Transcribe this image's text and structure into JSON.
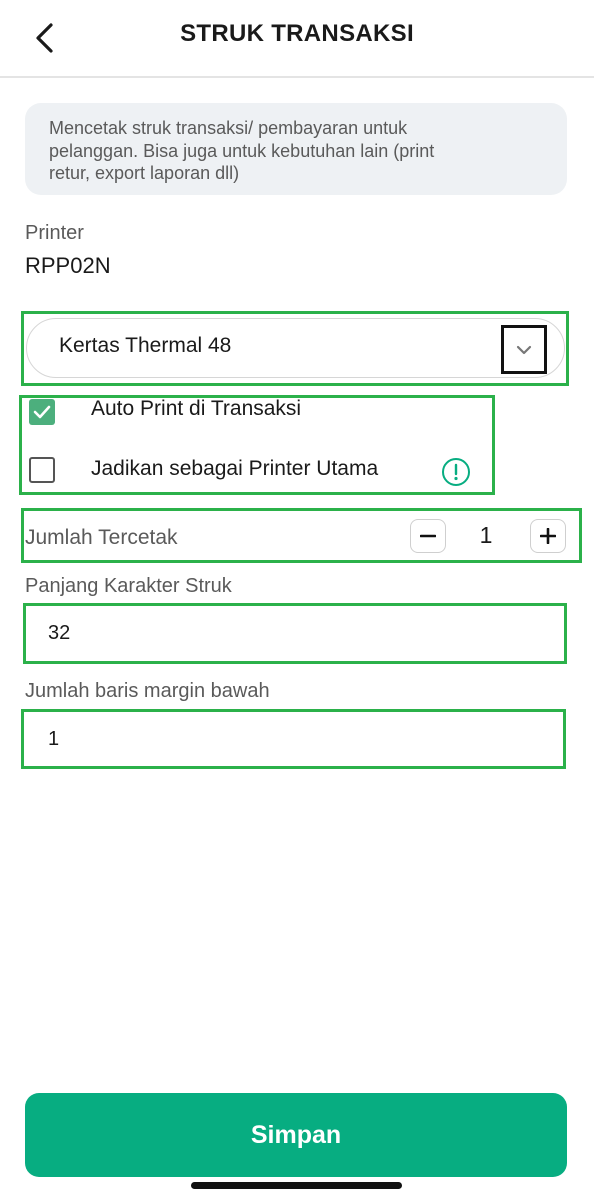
{
  "header": {
    "title": "STRUK TRANSAKSI"
  },
  "info": {
    "line1": "Mencetak struk transaksi/ pembayaran untuk",
    "line2": "pelanggan. Bisa juga untuk kebutuhan lain (print",
    "line3": "retur, export laporan dll)"
  },
  "printer": {
    "label": "Printer",
    "value": "RPP02N"
  },
  "paper": {
    "selected": "Kertas Thermal 48"
  },
  "options": {
    "auto_print": {
      "label": "Auto Print di Transaksi",
      "checked": true
    },
    "main_printer": {
      "label": "Jadikan sebagai Printer Utama",
      "checked": false
    }
  },
  "copies": {
    "label": "Jumlah Tercetak",
    "value": "1",
    "minus": "−",
    "plus": "+"
  },
  "char_length": {
    "label": "Panjang Karakter Struk",
    "value": "32"
  },
  "bottom_margin": {
    "label": "Jumlah baris margin bawah",
    "value": "1"
  },
  "actions": {
    "save_label": "Simpan"
  },
  "colors": {
    "accent": "#07ad81",
    "highlight_frame": "#2bb14a",
    "checkbox_checked": "#4caf7d"
  }
}
